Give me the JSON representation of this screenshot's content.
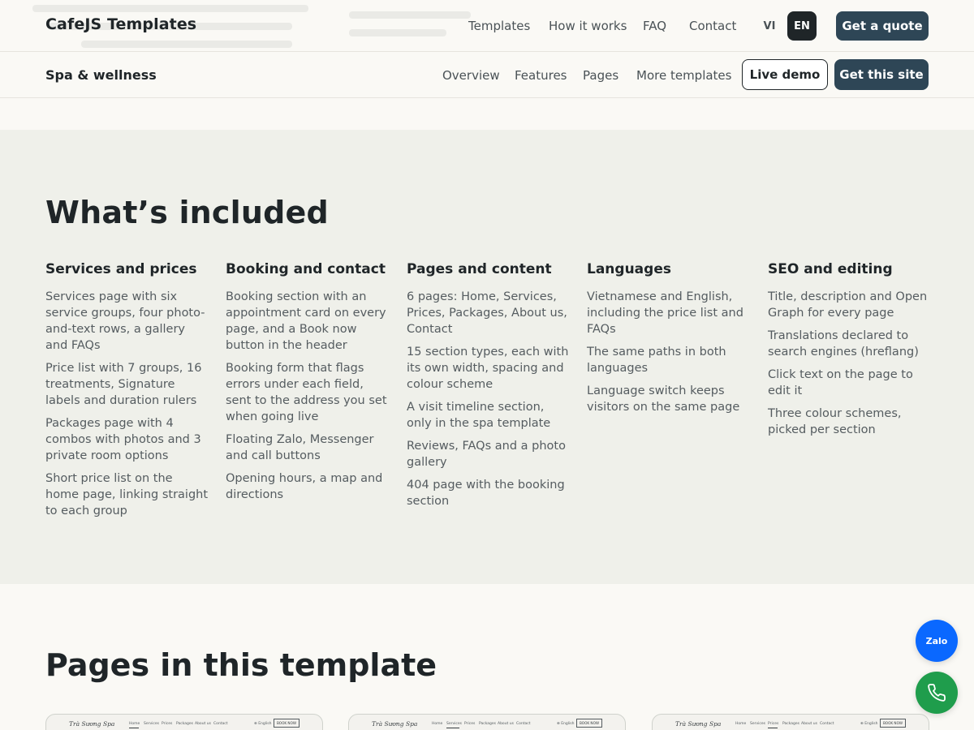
{
  "header": {
    "brand": "CafeJS Templates",
    "nav": [
      "Templates",
      "How it works",
      "FAQ",
      "Contact"
    ],
    "lang_vi": "VI",
    "lang_en": "EN",
    "cta": "Get a quote"
  },
  "subheader": {
    "title": "Spa & wellness",
    "nav": [
      "Overview",
      "Features",
      "Pages",
      "More templates"
    ],
    "live_demo": "Live demo",
    "get_site": "Get this site"
  },
  "included": {
    "title": "What’s included",
    "columns": [
      {
        "heading": "Services and prices",
        "items": [
          "Services page with six service groups, four photo-and-text rows, a gallery and FAQs",
          "Price list with 7 groups, 16 treatments, Signature labels and duration rulers",
          "Packages page with 4 combos with photos and 3 private room options",
          "Short price list on the home page, linking straight to each group"
        ]
      },
      {
        "heading": "Booking and contact",
        "items": [
          "Booking section with an appointment card on every page, and a Book now button in the header",
          "Booking form that flags errors under each field, sent to the address you set when going live",
          "Floating Zalo, Messenger and call buttons",
          "Opening hours, a map and directions"
        ]
      },
      {
        "heading": "Pages and content",
        "items": [
          "6 pages: Home, Services, Prices, Packages, About us, Contact",
          "15 section types, each with its own width, spacing and colour scheme",
          "A visit timeline section, only in the spa template",
          "Reviews, FAQs and a photo gallery",
          "404 page with the booking section"
        ]
      },
      {
        "heading": "Languages",
        "items": [
          "Vietnamese and English, including the price list and FAQs",
          "The same paths in both languages",
          "Language switch keeps visitors on the same page"
        ]
      },
      {
        "heading": "SEO and editing",
        "items": [
          "Title, description and Open Graph for every page",
          "Translations declared to search engines (hreflang)",
          "Click text on the page to edit it",
          "Three colour schemes, picked per section"
        ]
      }
    ]
  },
  "pages_section": {
    "title": "Pages in this template",
    "thumbs": [
      {
        "brand": "Trà Sương Spa",
        "nav": [
          "Home",
          "Services",
          "Prices",
          "Packages",
          "About us",
          "Contact"
        ],
        "lang": "⊕ English",
        "book": "BOOK NOW"
      },
      {
        "brand": "Trà Sương Spa",
        "nav": [
          "Home",
          "Services",
          "Prices",
          "Packages",
          "About us",
          "Contact"
        ],
        "lang": "⊕ English",
        "book": "BOOK NOW"
      },
      {
        "brand": "Trà Sương Spa",
        "nav": [
          "Home",
          "Services",
          "Prices",
          "Packages",
          "About us",
          "Contact"
        ],
        "lang": "⊕ English",
        "book": "BOOK NOW"
      }
    ]
  },
  "floating": {
    "zalo": "Zalo",
    "call_icon": "phone-icon"
  },
  "colors": {
    "primary": "#2e4656",
    "dark": "#1f2528",
    "zalo": "#0a68ff",
    "call": "#1f9d4c",
    "section_bg": "#eff0ea"
  }
}
